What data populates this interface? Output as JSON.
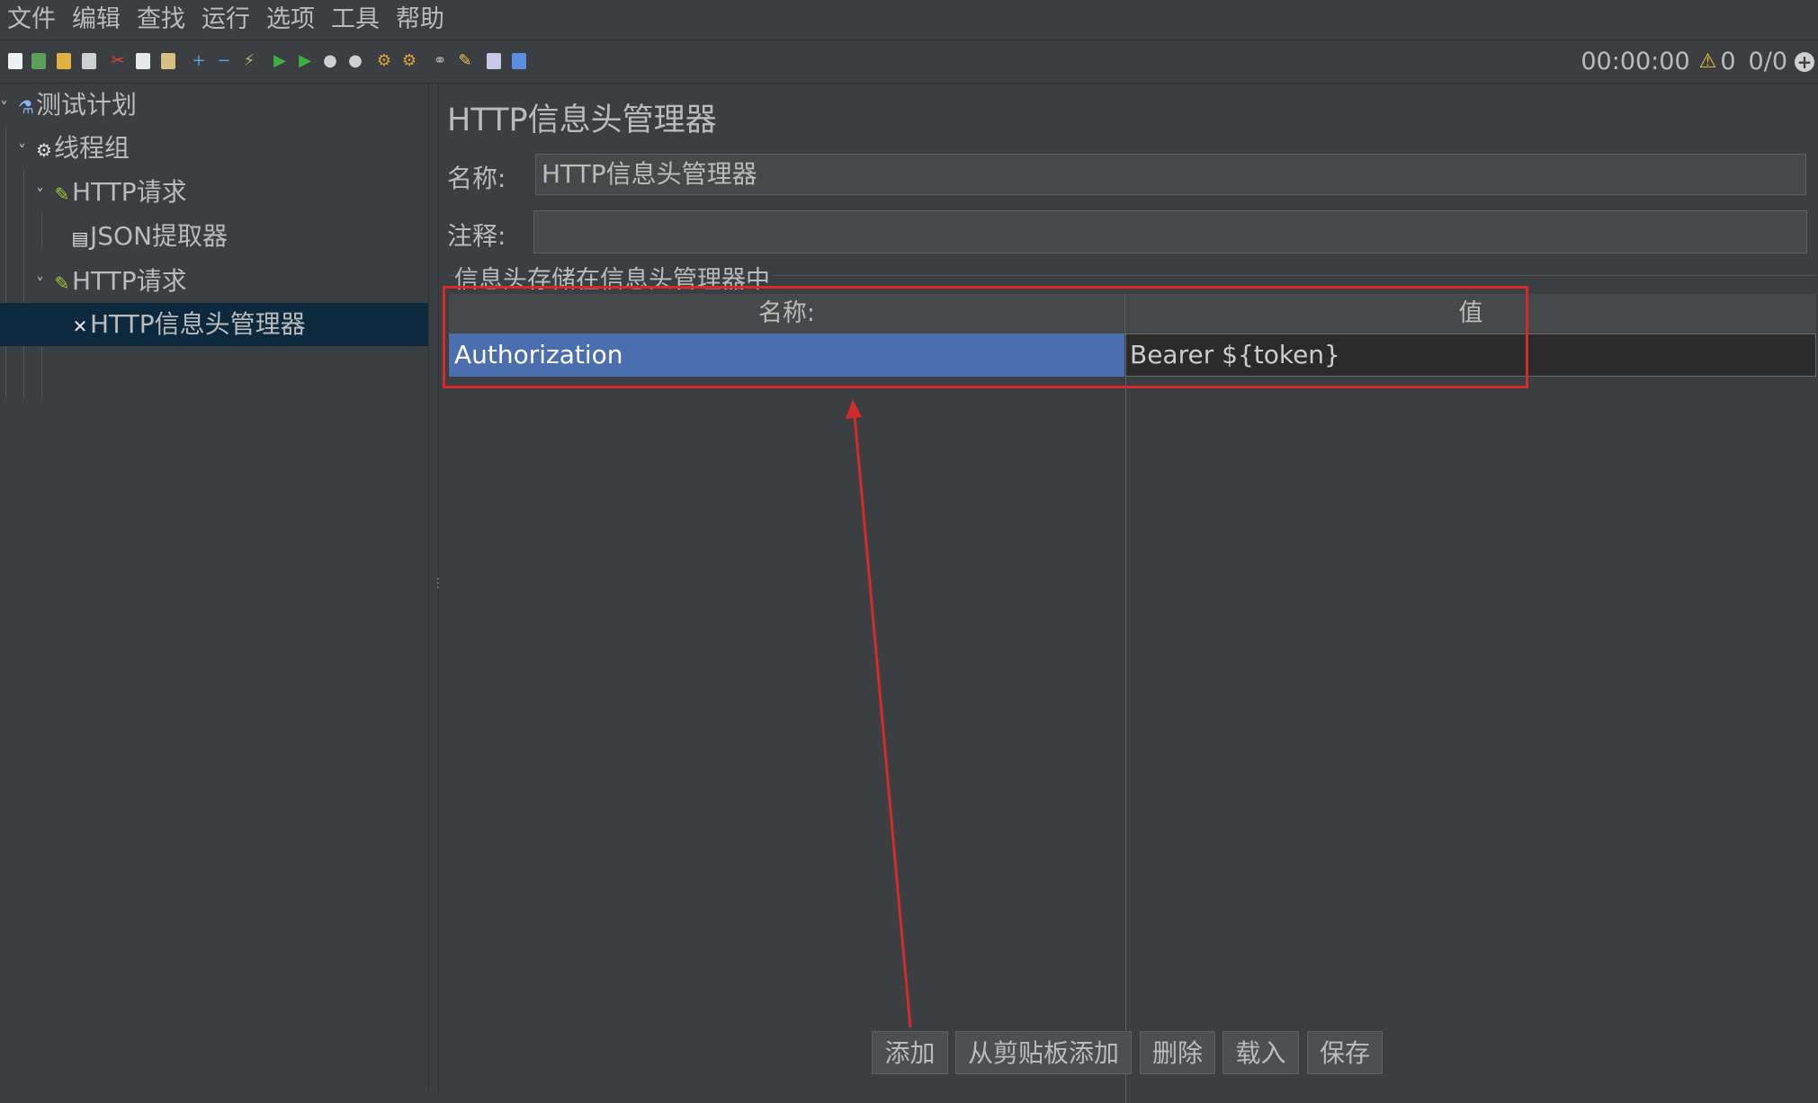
{
  "menu": [
    "文件",
    "编辑",
    "查找",
    "运行",
    "选项",
    "工具",
    "帮助"
  ],
  "status": {
    "time": "00:00:00",
    "warnings": "0",
    "threads": "0/0"
  },
  "tree": {
    "plan": "测试计划",
    "thread_group": "线程组",
    "http_request_1": "HTTP请求",
    "json_extractor": "JSON提取器",
    "http_request_2": "HTTP请求",
    "header_manager": "HTTP信息头管理器"
  },
  "panel": {
    "title": "HTTP信息头管理器",
    "name_label": "名称:",
    "name_value": "HTTP信息头管理器",
    "comment_label": "注释:",
    "comment_value": "",
    "group_title": "信息头存储在信息头管理器中"
  },
  "table": {
    "headers": [
      "名称:",
      "值"
    ],
    "rows": [
      {
        "name": "Authorization",
        "value": "Bearer ${token}"
      }
    ]
  },
  "buttons": {
    "add": "添加",
    "add_clipboard": "从剪贴板添加",
    "delete": "删除",
    "load": "载入",
    "save": "保存"
  },
  "colors": {
    "accent_selection": "#4b6eaf",
    "tree_selection": "#0d293e",
    "annotation_red": "#d42a2a"
  }
}
